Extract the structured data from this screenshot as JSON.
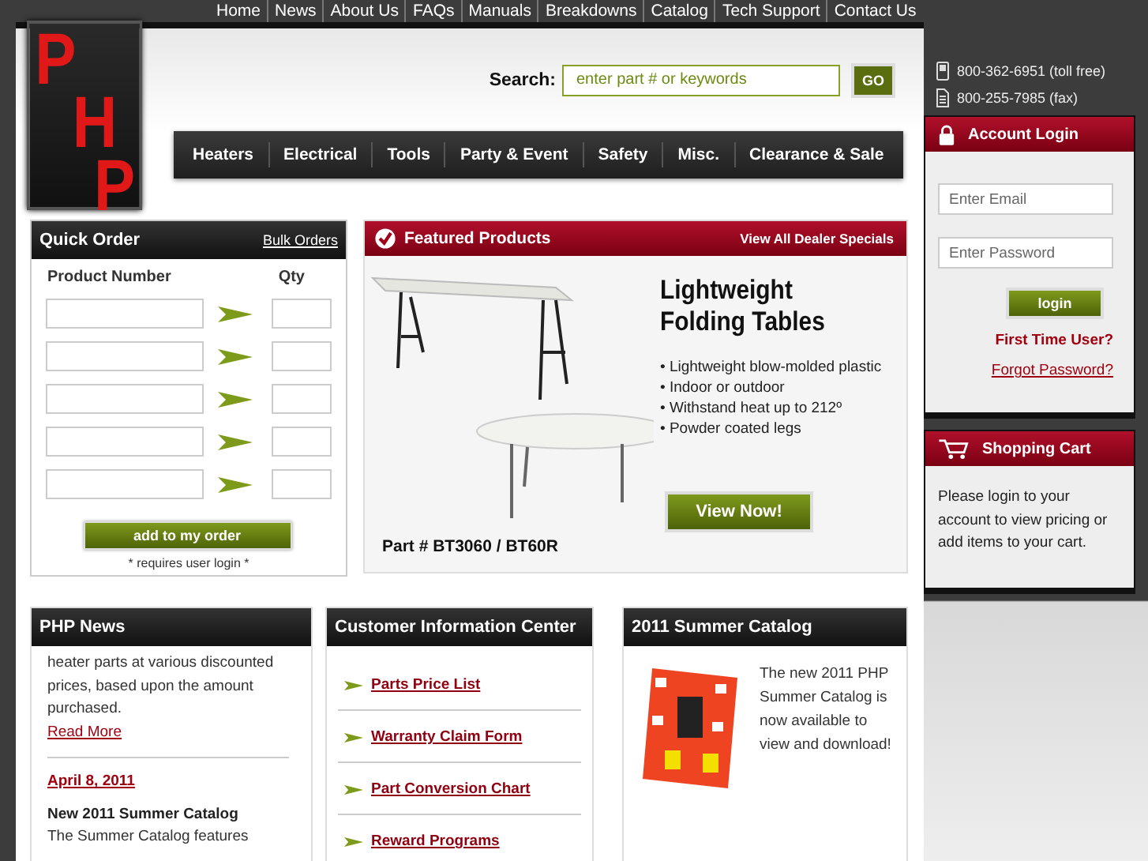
{
  "top_nav": [
    {
      "label": "Home"
    },
    {
      "label": "News"
    },
    {
      "label": "About Us"
    },
    {
      "label": "FAQs"
    },
    {
      "label": "Manuals"
    },
    {
      "label": "Breakdowns"
    },
    {
      "label": "Catalog"
    },
    {
      "label": "Tech Support"
    },
    {
      "label": "Contact Us"
    }
  ],
  "logo": {
    "letters": [
      "P",
      "H",
      "P"
    ]
  },
  "contact": [
    {
      "kind": "phone",
      "text": "800-362-6951 (toll free)"
    },
    {
      "kind": "fax",
      "text": "800-255-7985 (fax)"
    }
  ],
  "search": {
    "label": "Search:",
    "placeholder": "enter part # or keywords",
    "button": "GO"
  },
  "categories": [
    {
      "label": "Heaters"
    },
    {
      "label": "Electrical"
    },
    {
      "label": "Tools"
    },
    {
      "label": "Party & Event"
    },
    {
      "label": "Safety"
    },
    {
      "label": "Misc."
    },
    {
      "label": "Clearance & Sale"
    }
  ],
  "quick_order": {
    "title": "Quick Order",
    "link": "Bulk Orders",
    "col_product": "Product Number",
    "col_qty": "Qty",
    "rows": [
      {
        "kind": "entry"
      },
      {
        "kind": "entry"
      },
      {
        "kind": "entry"
      },
      {
        "kind": "entry"
      },
      {
        "kind": "entry"
      }
    ],
    "button": "add to my order",
    "note": "* requires user login *"
  },
  "featured": {
    "title": "Featured Products",
    "link": "View All Dealer Specials",
    "headline": [
      "Lightweight",
      "Folding Tables"
    ],
    "bullets": [
      "• Lightweight blow-molded plastic",
      "• Indoor or outdoor",
      "• Withstand heat up to 212º",
      "• Powder coated legs"
    ],
    "part": "Part # BT3060 / BT60R",
    "button": "View Now!"
  },
  "account_login": {
    "title": "Account Login",
    "email_placeholder": "Enter Email",
    "password_placeholder": "Enter Password",
    "button": "login",
    "first_time": "First Time User?",
    "forgot": "Forgot Password?"
  },
  "shopping_cart": {
    "title": "Shopping Cart",
    "text": "Please login to your account to view pricing or add items to your cart."
  },
  "news": {
    "title": "PHP News",
    "paragraph": "heater parts at various discounted prices, based upon the amount purchased.",
    "link": "Read More",
    "date": "April 8, 2011",
    "headline": "New 2011 Summer Catalog",
    "text": "The Summer Catalog features"
  },
  "info_center": {
    "title": "Customer Information Center",
    "links": [
      {
        "label": "Parts Price List"
      },
      {
        "label": "Warranty Claim Form"
      },
      {
        "label": "Part Conversion Chart"
      },
      {
        "label": "Reward Programs"
      }
    ]
  },
  "catalog": {
    "title": "2011 Summer Catalog",
    "text": "The new 2011 PHP Summer Catalog is now available to view and download!"
  }
}
